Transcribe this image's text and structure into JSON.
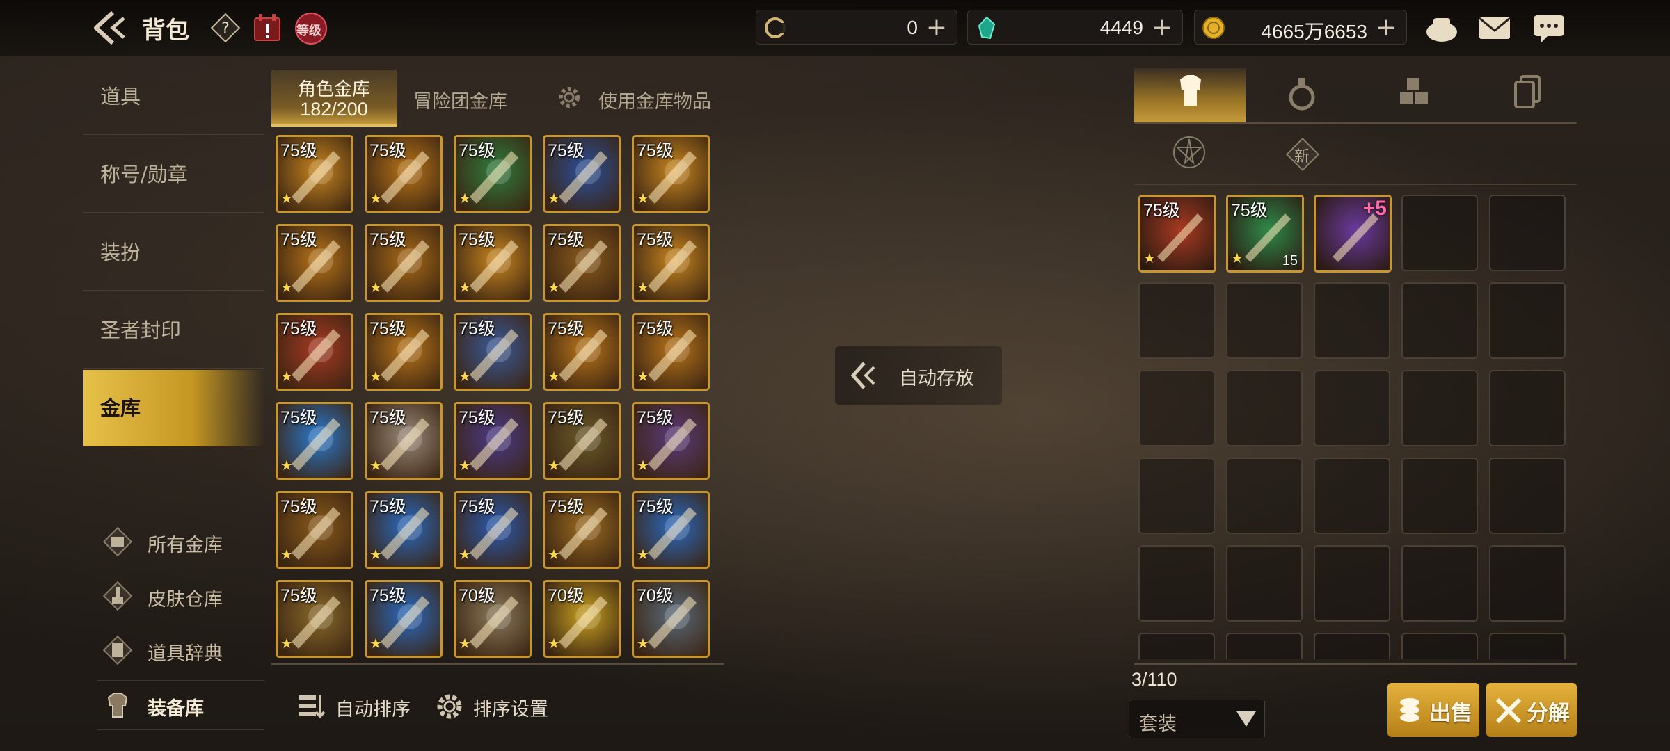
{
  "header": {
    "title": "背包",
    "level_badge": "等级",
    "resources": [
      {
        "name": "cera",
        "value": "0"
      },
      {
        "name": "crystal",
        "value": "4449"
      },
      {
        "name": "gold",
        "value": "4665万6653"
      }
    ]
  },
  "sidebar": {
    "items": [
      {
        "label": "道具"
      },
      {
        "label": "称号/勋章"
      },
      {
        "label": "装扮"
      },
      {
        "label": "圣者封印"
      },
      {
        "label": "金库"
      }
    ],
    "sub_items": [
      {
        "label": "所有金库"
      },
      {
        "label": "皮肤仓库"
      },
      {
        "label": "道具辞典"
      },
      {
        "label": "装备库"
      }
    ]
  },
  "storage": {
    "tabs": {
      "character_label": "角色金库",
      "character_count": "182/200",
      "guild_label": "冒险团金库",
      "use_label": "使用金库物品"
    },
    "items": [
      {
        "level": "75级",
        "color": "#c8861e"
      },
      {
        "level": "75级",
        "color": "#b87418"
      },
      {
        "level": "75级",
        "color": "#2f7d3d"
      },
      {
        "level": "75级",
        "color": "#2a4f9a"
      },
      {
        "level": "75级",
        "color": "#c8861e"
      },
      {
        "level": "75级",
        "color": "#b87418"
      },
      {
        "level": "75级",
        "color": "#a86a16"
      },
      {
        "level": "75级",
        "color": "#c8861e"
      },
      {
        "level": "75级",
        "color": "#8a5a1a"
      },
      {
        "level": "75级",
        "color": "#c8861e"
      },
      {
        "level": "75级",
        "color": "#a83a22"
      },
      {
        "level": "75级",
        "color": "#b87418"
      },
      {
        "level": "75级",
        "color": "#3a5a9a"
      },
      {
        "level": "75级",
        "color": "#b87418"
      },
      {
        "level": "75级",
        "color": "#b87418"
      },
      {
        "level": "75级",
        "color": "#2a7ad0"
      },
      {
        "level": "75级",
        "color": "#9a8a7a"
      },
      {
        "level": "75级",
        "color": "#4a3a8a"
      },
      {
        "level": "75级",
        "color": "#6a5a2a"
      },
      {
        "level": "75级",
        "color": "#5a3a7a"
      },
      {
        "level": "75级",
        "color": "#8a5a1a"
      },
      {
        "level": "75级",
        "color": "#2a6ac0"
      },
      {
        "level": "75级",
        "color": "#2a5ab0"
      },
      {
        "level": "75级",
        "color": "#9a6a20"
      },
      {
        "level": "75级",
        "color": "#2a6ac0"
      },
      {
        "level": "75级",
        "color": "#8a6a2a"
      },
      {
        "level": "75级",
        "color": "#2a6ac0"
      },
      {
        "level": "70级",
        "color": "#8a7a5a"
      },
      {
        "level": "70级",
        "color": "#c8a020"
      },
      {
        "level": "70级",
        "color": "#5a6a7a"
      }
    ],
    "auto_sort": "自动排序",
    "sort_settings": "排序设置"
  },
  "auto_store": "自动存放",
  "inventory": {
    "sub_tab_new": "新",
    "items": [
      {
        "level": "75级",
        "color": "#a83a22",
        "count": ""
      },
      {
        "level": "75级",
        "color": "#2f8a4a",
        "count": "15"
      },
      {
        "level": "",
        "color": "#6a3aa0",
        "count": "",
        "enhance": "+5"
      }
    ],
    "count": "3/110",
    "filter": "套装",
    "sell": "出售",
    "disassemble": "分解"
  },
  "colors": {
    "accent": "#e3be5e",
    "gold_btn": "#d9a22e"
  }
}
